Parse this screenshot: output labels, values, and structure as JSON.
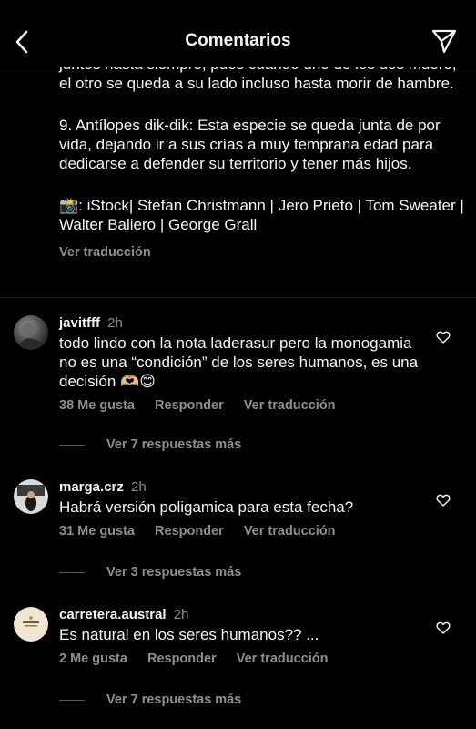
{
  "header": {
    "title": "Comentarios"
  },
  "caption": {
    "paragraph_1": "juntos hasta siempre, pues cuando uno de los dos muere, el otro se queda a su lado incluso hasta morir de hambre.",
    "paragraph_2": "9. Antílopes dik-dik: Esta especie se queda junta de por vida, dejando ir a sus crías a muy temprana edad para dedicarse a defender su territorio y tener más hijos.",
    "credits": "📸: iStock| Stefan Christmann | Jero Prieto | Tom Sweater | Walter Baliero | George Grall",
    "translate_label": "Ver traducción"
  },
  "comments": [
    {
      "username": "javitfff",
      "time": "2h",
      "text": "todo lindo con la nota laderasur pero la monogamia no es una “condición” de los seres humanos, es una decisión 🫶🏼😊",
      "likes": "38 Me gusta",
      "reply_label": "Responder",
      "translate_label": "Ver traducción",
      "more_replies": "Ver 7 respuestas más"
    },
    {
      "username": "marga.crz",
      "time": "2h",
      "text": "Habrá versión poligamica para esta fecha?",
      "likes": "31 Me gusta",
      "reply_label": "Responder",
      "translate_label": "Ver traducción",
      "more_replies": "Ver 3 respuestas más"
    },
    {
      "username": "carretera.austral",
      "time": "2h",
      "text": "Es natural en los seres humanos?? ...",
      "likes": "2 Me gusta",
      "reply_label": "Responder",
      "translate_label": "Ver traducción",
      "more_replies": "Ver 7 respuestas más"
    }
  ],
  "colors": {
    "background": "#000000",
    "text": "#f5f5f5",
    "secondary_text": "#8e8e8e"
  },
  "icons": [
    "back-arrow-icon",
    "send-icon",
    "heart-icon"
  ]
}
